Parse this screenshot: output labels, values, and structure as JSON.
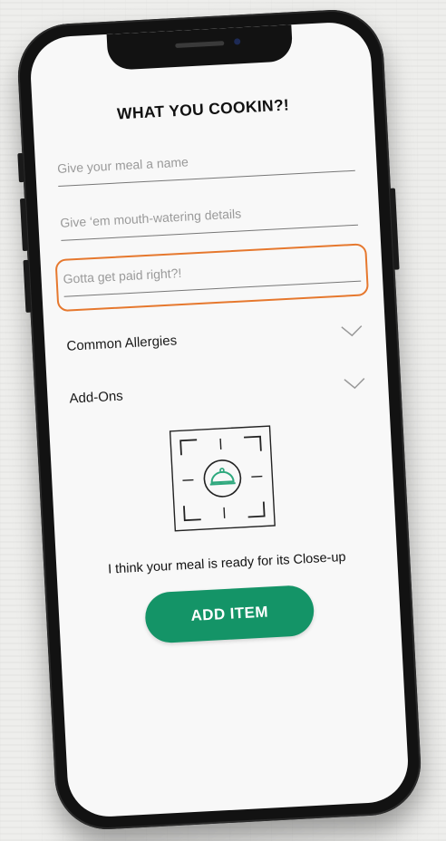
{
  "header": {
    "title": "WHAT YOU COOKIN?!"
  },
  "form": {
    "name_placeholder": "Give your meal a name",
    "details_placeholder": "Give ‘em mouth-watering details",
    "price_placeholder": "Gotta get paid right?!"
  },
  "sections": {
    "allergies_label": "Common Allergies",
    "addons_label": "Add-Ons"
  },
  "photo": {
    "caption": "I think your meal is ready for its Close-up"
  },
  "actions": {
    "add_item_label": "ADD ITEM"
  },
  "colors": {
    "accent_green": "#149467",
    "highlight_orange": "#e6782e",
    "icon_green": "#2ea87d"
  },
  "icons": {
    "chevron": "chevron-down-icon",
    "camera_frame": "camera-frame-icon",
    "cloche": "cloche-icon"
  }
}
